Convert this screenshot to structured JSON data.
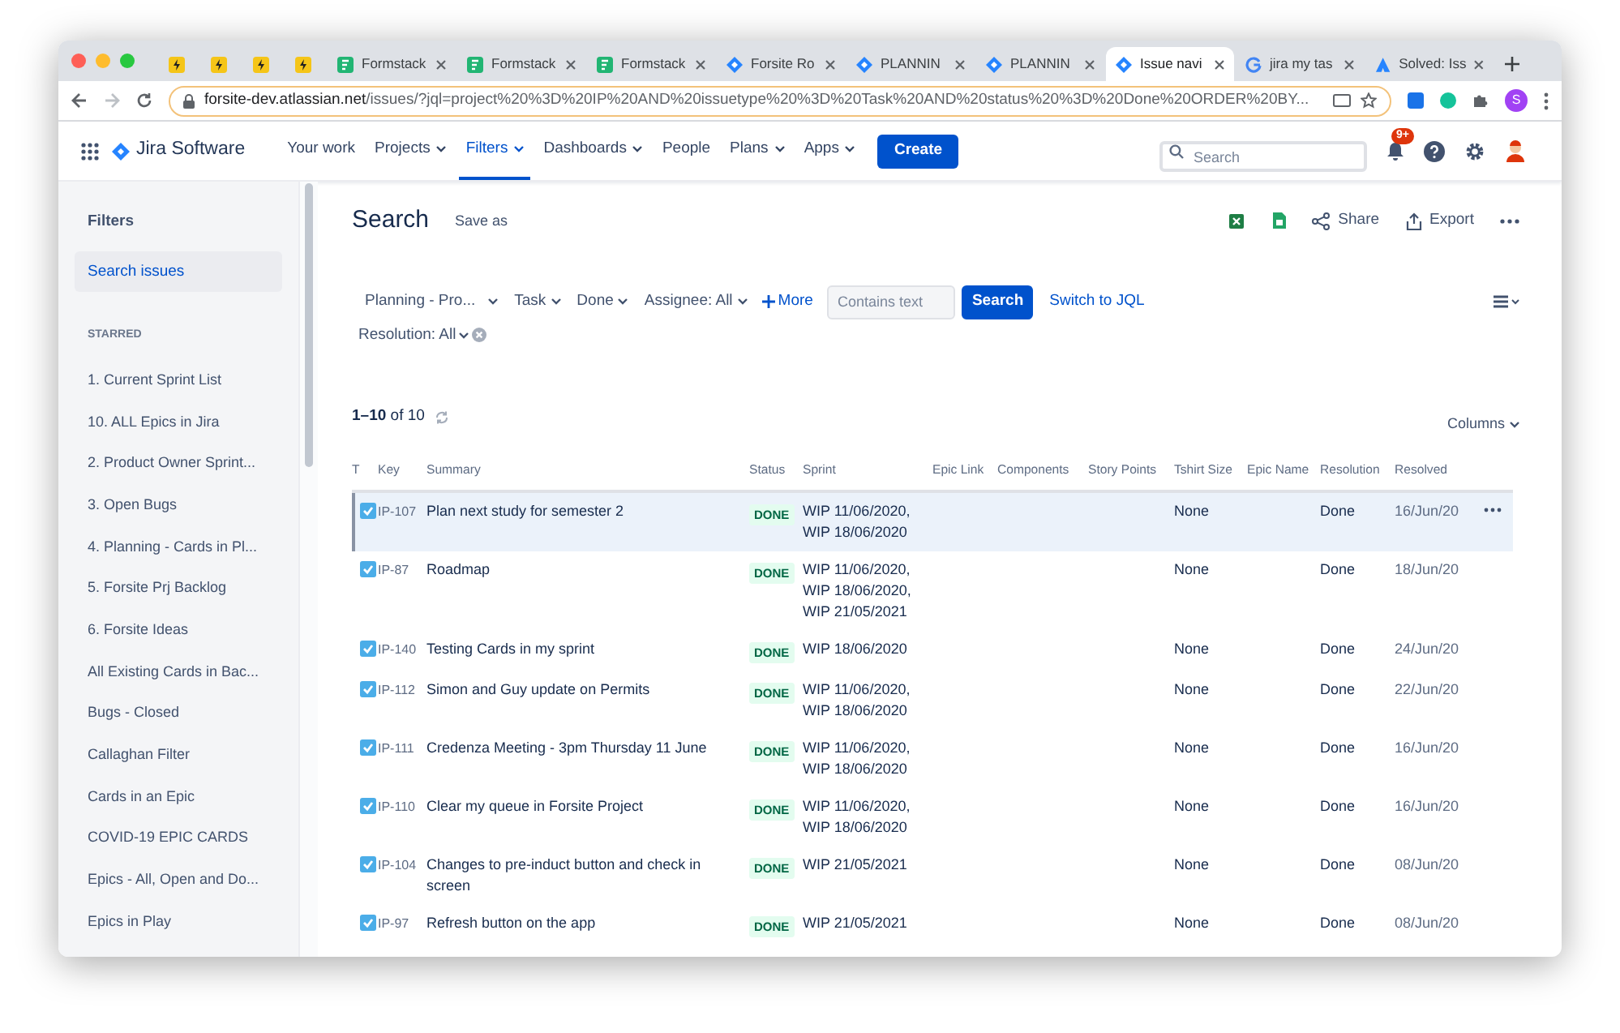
{
  "browser": {
    "tabs": [
      {
        "kind": "yellow",
        "selected": false
      },
      {
        "kind": "yellow",
        "selected": false
      },
      {
        "kind": "yellow",
        "selected": false
      },
      {
        "kind": "yellow",
        "selected": false
      },
      {
        "kind": "formstack",
        "title": "Formstack",
        "selected": false
      },
      {
        "kind": "formstack",
        "title": "Formstack",
        "selected": false
      },
      {
        "kind": "formstack",
        "title": "Formstack",
        "selected": false
      },
      {
        "kind": "jira",
        "title": "Forsite Ro",
        "selected": false
      },
      {
        "kind": "jira",
        "title": "PLANNIN",
        "selected": false
      },
      {
        "kind": "jira",
        "title": "PLANNIN",
        "selected": false
      },
      {
        "kind": "jira",
        "title": "Issue navi",
        "selected": true
      },
      {
        "kind": "google",
        "title": "jira my tas",
        "selected": false
      },
      {
        "kind": "atlassian",
        "title": "Solved: Iss",
        "selected": false
      }
    ],
    "url_host": "forsite-dev.atlassian.net",
    "url_path": "/issues/?jql=project%20%3D%20IP%20AND%20issuetype%20%3D%20Task%20AND%20status%20%3D%20Done%20ORDER%20BY...",
    "profile_initial": "S"
  },
  "nav": {
    "product": "Jira Software",
    "items": [
      {
        "label": "Your work",
        "dropdown": false,
        "selected": false
      },
      {
        "label": "Projects",
        "dropdown": true,
        "selected": false
      },
      {
        "label": "Filters",
        "dropdown": true,
        "selected": true
      },
      {
        "label": "Dashboards",
        "dropdown": true,
        "selected": false
      },
      {
        "label": "People",
        "dropdown": false,
        "selected": false
      },
      {
        "label": "Plans",
        "dropdown": true,
        "selected": false
      },
      {
        "label": "Apps",
        "dropdown": true,
        "selected": false
      }
    ],
    "create": "Create",
    "search_placeholder": "Search",
    "notifications": "9+"
  },
  "sidebar": {
    "title": "Filters",
    "items": [
      {
        "label": "Search issues",
        "selected": true
      }
    ],
    "section": "STARRED",
    "starred": [
      "1. Current Sprint List",
      "10. ALL Epics in Jira",
      "2. Product Owner Sprint...",
      "3. Open Bugs",
      "4. Planning - Cards in Pl...",
      "5. Forsite Prj Backlog",
      "6. Forsite Ideas",
      "All Existing Cards in Bac...",
      "Bugs - Closed",
      "Callaghan Filter",
      "Cards in an Epic",
      "COVID-19 EPIC CARDS",
      "Epics - All, Open and Do...",
      "Epics in Play"
    ]
  },
  "header": {
    "title": "Search",
    "save_as": "Save as",
    "share": "Share",
    "export": "Export"
  },
  "filters": {
    "chips": [
      "Planning - Pro...",
      "Task",
      "Done",
      "Assignee: All"
    ],
    "more": "More",
    "text_placeholder": "Contains text",
    "search": "Search",
    "switch": "Switch to JQL",
    "resolution": "Resolution: All"
  },
  "results": {
    "count_bold": "1–10",
    "count_rest": "of 10",
    "columns_button": "Columns"
  },
  "table": {
    "columns": [
      "T",
      "Key",
      "Summary",
      "Status",
      "Sprint",
      "Epic Link",
      "Components",
      "Story Points",
      "Tshirt Size",
      "Epic Name",
      "Resolution",
      "Resolved"
    ],
    "rows": [
      {
        "key": "IP-107",
        "summary": "Plan next study for semester 2",
        "status": "DONE",
        "sprint": [
          "WIP 11/06/2020,",
          "WIP 18/06/2020"
        ],
        "tshirt": "None",
        "resolution": "Done",
        "resolved": "16/Jun/20",
        "selected": true
      },
      {
        "key": "IP-87",
        "summary": "Roadmap",
        "status": "DONE",
        "sprint": [
          "WIP 11/06/2020,",
          "WIP 18/06/2020,",
          "WIP 21/05/2021"
        ],
        "tshirt": "None",
        "resolution": "Done",
        "resolved": "18/Jun/20",
        "selected": false
      },
      {
        "key": "IP-140",
        "summary": "Testing Cards in my sprint",
        "status": "DONE",
        "sprint": [
          "WIP 18/06/2020"
        ],
        "tshirt": "None",
        "resolution": "Done",
        "resolved": "24/Jun/20",
        "selected": false
      },
      {
        "key": "IP-112",
        "summary": "Simon and Guy update on Permits",
        "status": "DONE",
        "sprint": [
          "WIP 11/06/2020,",
          "WIP 18/06/2020"
        ],
        "tshirt": "None",
        "resolution": "Done",
        "resolved": "22/Jun/20",
        "selected": false
      },
      {
        "key": "IP-111",
        "summary": "Credenza Meeting - 3pm Thursday 11 June",
        "status": "DONE",
        "sprint": [
          "WIP 11/06/2020,",
          "WIP 18/06/2020"
        ],
        "tshirt": "None",
        "resolution": "Done",
        "resolved": "16/Jun/20",
        "selected": false
      },
      {
        "key": "IP-110",
        "summary": "Clear my queue in Forsite Project",
        "status": "DONE",
        "sprint": [
          "WIP 11/06/2020,",
          "WIP 18/06/2020"
        ],
        "tshirt": "None",
        "resolution": "Done",
        "resolved": "16/Jun/20",
        "selected": false
      },
      {
        "key": "IP-104",
        "summary": "Changes to pre-induct button and check in screen",
        "status": "DONE",
        "sprint": [
          "WIP 21/05/2021"
        ],
        "tshirt": "None",
        "resolution": "Done",
        "resolved": "08/Jun/20",
        "selected": false
      },
      {
        "key": "IP-97",
        "summary": "Refresh button on the app",
        "status": "DONE",
        "sprint": [
          "WIP 21/05/2021"
        ],
        "tshirt": "None",
        "resolution": "Done",
        "resolved": "08/Jun/20",
        "selected": false
      }
    ]
  }
}
